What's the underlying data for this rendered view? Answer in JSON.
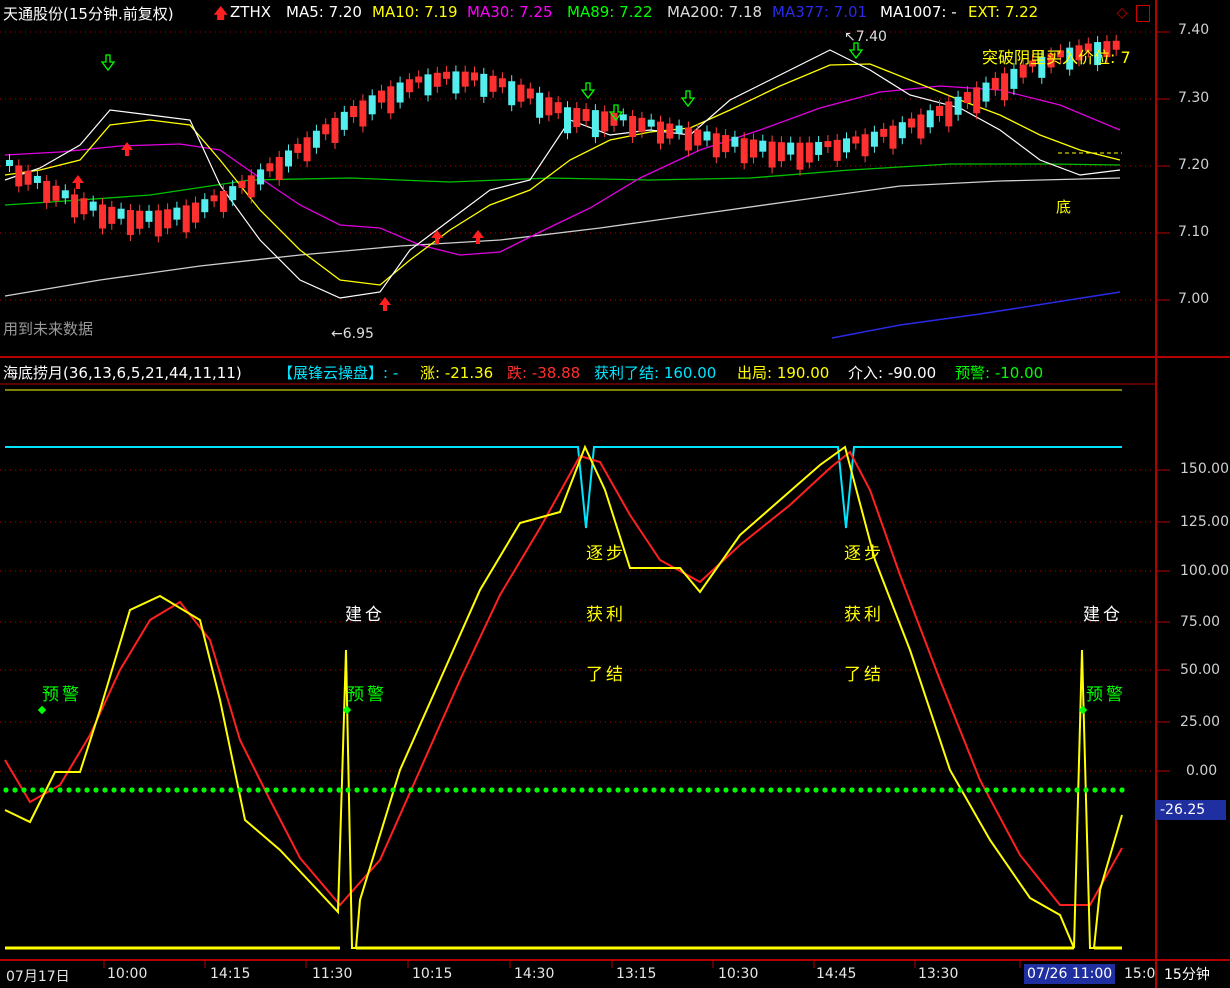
{
  "header": {
    "stock": "天通股份(15分钟.前复权)",
    "tag": "ZTHX",
    "ma": [
      {
        "label": "MA5: 7.20",
        "color": "#ffffff"
      },
      {
        "label": "MA10: 7.19",
        "color": "#ffff00"
      },
      {
        "label": "MA30: 7.25",
        "color": "#ff00ff"
      },
      {
        "label": "MA89: 7.22",
        "color": "#00ff00"
      },
      {
        "label": "MA200: 7.18",
        "color": "#dddddd"
      },
      {
        "label": "MA377: 7.01",
        "color": "#2a2ae6"
      },
      {
        "label": "MA1007: -",
        "color": "#ffffff"
      },
      {
        "label": "EXT: 7.22",
        "color": "#ffff00"
      }
    ]
  },
  "price_panel": {
    "high_label": "7.40",
    "low_label": "6.95",
    "breakout_note": "突破阴里买入价位: 7",
    "future_note": "用到未来数据",
    "bottom_mark": "底",
    "price_axis": [
      "7.40",
      "7.30",
      "7.20",
      "7.10",
      "7.00"
    ]
  },
  "indicator": {
    "name": "海底捞月(36,13,6,5,21,44,11,11)",
    "bracket": "【展锋云操盘】: -",
    "values": [
      {
        "label": "涨: -21.36",
        "color": "#ffff00"
      },
      {
        "label": "跌: -38.88",
        "color": "#ff3030"
      },
      {
        "label": "获利了结: 160.00",
        "color": "#00e5ff"
      },
      {
        "label": "出局: 190.00",
        "color": "#ffff00"
      },
      {
        "label": "介入: -90.00",
        "color": "#ffffff"
      },
      {
        "label": "预警: -10.00",
        "color": "#00ff00"
      }
    ],
    "axis": [
      "150.00",
      "125.00",
      "100.00",
      "75.00",
      "50.00",
      "25.00",
      "0.00"
    ],
    "current_value": "-26.25",
    "signals": {
      "build": "建仓",
      "warn": "预警",
      "step": "逐步",
      "profit": "获利",
      "close": "了结"
    }
  },
  "time_axis": [
    "07月17日",
    "10:00",
    "14:15",
    "11:30",
    "10:15",
    "14:30",
    "13:15",
    "10:30",
    "14:45",
    "13:30"
  ],
  "time_cursor": "07/26 11:00",
  "time_tail": "15:0",
  "period_button": "15分钟",
  "chart_data": {
    "type": "line",
    "panels": [
      {
        "name": "price",
        "y_range": [
          6.92,
          7.45
        ],
        "series": [
          "MA5",
          "MA10",
          "MA30",
          "MA89",
          "MA200",
          "MA377"
        ]
      },
      {
        "name": "海底捞月",
        "y_range": [
          -26.25,
          160
        ],
        "series": [
          {
            "name": "涨",
            "last": -21.36
          },
          {
            "name": "跌",
            "last": -38.88
          }
        ],
        "levels": {
          "获利了结": 160.0,
          "预警": -10.0
        }
      }
    ]
  }
}
